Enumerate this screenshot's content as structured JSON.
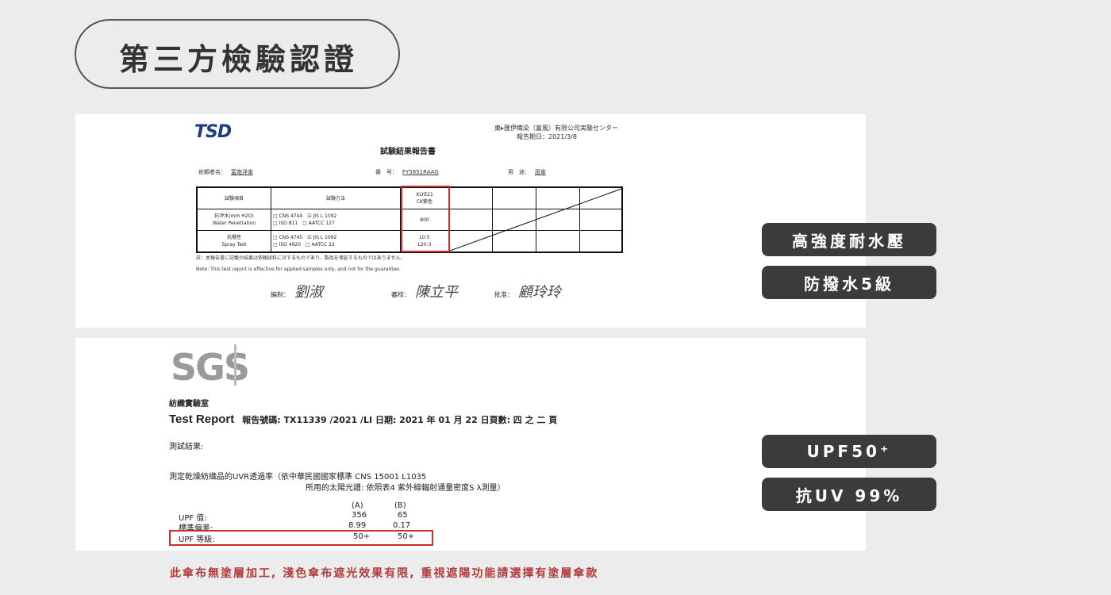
{
  "title": "第三方檢驗認證",
  "report1": {
    "logo": "TSD",
    "lab": "東▸匯伊織染（富風）有限公司実験センター",
    "date": "報告期日：2021/3/8",
    "heading": "試験結果報告書",
    "client_label": "依頼者名：",
    "client": "富南洋傘",
    "no_label": "番　号：",
    "no": "FY5851RAAG",
    "use_label": "用　途：",
    "use": "雨傘",
    "col_item": "試験項目",
    "col_method": "試験方法",
    "col_sample": "XLYE21\nCK紫色",
    "row1_item": "抗滲水(mm H2O)\nWater Penetration",
    "row1_method": "□ CNS 4744　☑ JIS L 1092\n□ ISO 811　□ AATCC 127",
    "row1_value": "800",
    "row2_item": "抗撥性\nSpray Test",
    "row2_method": "□ CNS 4745　☑ JIS L 1092\n□ ISO 4920　□ AATCC 22",
    "row2_value": "L0:5\nL20:3",
    "note_jp": "註：本報告書に記載の結果は依頼試料に対するものであり、製品を保証するものではありません。",
    "note_en": "Note: This test report is effective for applied samples only, and not for the guarantee.",
    "sig1_label": "編制：",
    "sig1": "劉淑",
    "sig2_label": "審核：",
    "sig2": "陳立平",
    "sig3_label": "批准：",
    "sig3": "顧玲玲"
  },
  "report2": {
    "logo": "SGS",
    "lab": "紡織實驗室",
    "report_label": "Test Report",
    "report_line": "報告號碼: TX11339 /2021 /LI 日期: 2021 年 01 月 22 日頁數: 四 之 二 頁",
    "result_label": "測試結果:",
    "measure1": "測定乾燥紡織品的UVR透過率（依中華民國國家標準 CNS 15001 L1035",
    "measure2": "所用的太陽光譜: 依照表4 紫外線輻射通量密度S λ測量）",
    "col_a": "(A)",
    "col_b": "(B)",
    "rows": [
      {
        "label": "UPF 值:",
        "a": "356",
        "b": "65"
      },
      {
        "label": "標準偏差:",
        "a": "8.99",
        "b": "0.17"
      },
      {
        "label": "UPF 等級:",
        "a": "50+",
        "b": "50+"
      }
    ]
  },
  "badges": {
    "b1": "高強度耐水壓",
    "b2": "防撥水5級",
    "b3": "UPF50⁺",
    "b4": "抗UV 99%"
  },
  "footer": "此傘布無塗層加工, 淺色傘布遮光效果有限, 重視遮陽功能請選擇有塗層傘款",
  "colors": {
    "accent_red": "#d42a2a",
    "badge_bg": "#3b3b3b",
    "footer_red": "#b23a3a"
  }
}
